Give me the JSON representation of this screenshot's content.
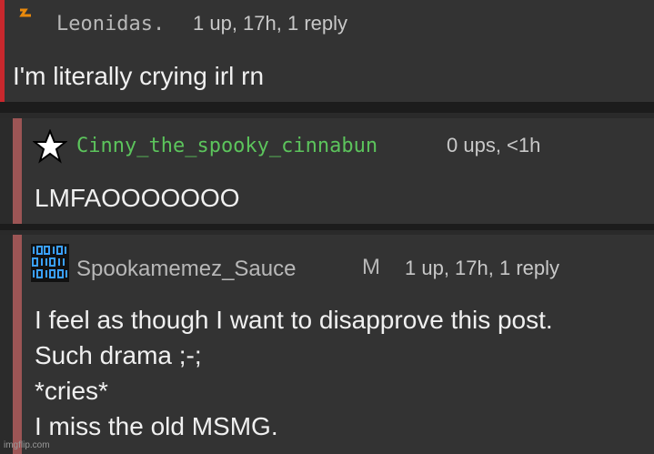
{
  "comments": [
    {
      "username": "Leonidas.",
      "meta": "1 up, 17h, 1 reply",
      "lines": [
        "I'm literally crying irl rn"
      ],
      "bar_color": "#c8282d",
      "username_color": "#b8b8b8",
      "icon": "orange-bolt-icon"
    },
    {
      "username": "Cinny_the_spooky_cinnabun",
      "meta": "0 ups, <1h",
      "lines": [
        "LMFAOOOOOOO"
      ],
      "bar_color": "#9c5555",
      "username_color": "#5cc45c",
      "icon": "star-icon"
    },
    {
      "username": "Spookamemez_Sauce",
      "badge": "M",
      "meta": "1 up, 17h, 1 reply",
      "lines": [
        "I feel as though I want to disapprove this post.",
        "Such drama ;-;",
        "*cries*",
        "I miss the old MSMG."
      ],
      "bar_color": "#9c5555",
      "username_color": "#b8b8b8",
      "icon": "binary-code-icon"
    }
  ],
  "watermark": "imgflip.com"
}
